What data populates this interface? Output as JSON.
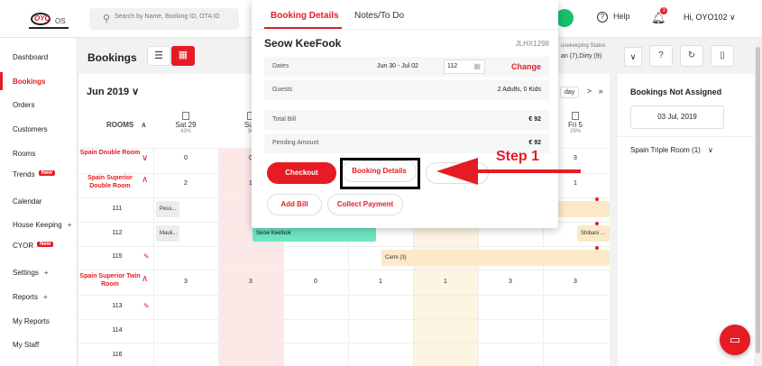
{
  "header": {
    "logo_text": "OYO",
    "logo_suffix": "OS",
    "search_placeholder": "Search by Name, Booking ID, OTA ID",
    "help_label": "Help",
    "notification_count": "3",
    "user_label": "Hi, OYO102 ∨"
  },
  "sidebar": {
    "items": [
      {
        "label": "Dashboard"
      },
      {
        "label": "Bookings"
      },
      {
        "label": "Orders"
      },
      {
        "label": "Customers"
      },
      {
        "label": "Rooms"
      },
      {
        "label": "Trends"
      },
      {
        "label": "Calendar"
      },
      {
        "label": "House Keeping"
      },
      {
        "label": "CYOR"
      },
      {
        "label": "Settings"
      },
      {
        "label": "Reports"
      },
      {
        "label": "My Reports"
      },
      {
        "label": "My Staff"
      }
    ],
    "new_badge": "New",
    "plus": "+"
  },
  "main": {
    "title": "Bookings",
    "month": "Jun 2019",
    "rooms_header": "ROOMS",
    "housekeeping_label": "usekeeping Status",
    "housekeeping_value": "an (7),Dirty (9)",
    "nav_day": "day",
    "nav_next": ">",
    "nav_last": "»"
  },
  "grid": {
    "columns": [
      {
        "day": "Sat 29",
        "pct": "43%"
      },
      {
        "day": "Sun",
        "pct": "36"
      },
      {
        "day": "",
        "pct": ""
      },
      {
        "day": "",
        "pct": ""
      },
      {
        "day": "",
        "pct": ""
      },
      {
        "day": "Fri 5",
        "pct": "29%"
      }
    ],
    "rows": {
      "spain_double": "Spain Double Room",
      "spain_superior_double": "Spain Superior Double Room",
      "r111": "111",
      "r112": "112",
      "r115": "115",
      "spain_superior_twin": "Spain Superior Twin Room",
      "r113": "113",
      "r114": "114",
      "r116": "116"
    },
    "counts": {
      "double": [
        "0",
        "0",
        "3"
      ],
      "superior_double": [
        "2",
        "1",
        "1"
      ],
      "twin": [
        "3",
        "3",
        "0",
        "1",
        "1",
        "3",
        "3"
      ]
    },
    "bookings": {
      "pess": "Pess...",
      "mauli": "Mauli...",
      "seow": "Seow Keefook",
      "carm": "Carm (3)",
      "shibani": "Shibani ..."
    }
  },
  "right_panel": {
    "title": "Bookings Not Assigned",
    "date": "03 Jul, 2019",
    "room": "Spain Triple Room (1)"
  },
  "popup": {
    "tab_active": "Booking Details",
    "tab_other": "Notes/To Do",
    "guest_name": "Seow KeeFook",
    "booking_id": "JLHX1298",
    "dates_label": "Dates",
    "dates_value": "Jun 30 - Jul 02",
    "room_no": "112",
    "change_link": "Change",
    "guests_label": "Guests",
    "guests_value": "2 Adults, 0 Kids",
    "total_label": "Total Bill",
    "total_value": "€ 92",
    "pending_label": "Pending Amount",
    "pending_value": "€ 92",
    "checkout_btn": "Checkout",
    "booking_details_btn": "Booking Details",
    "add_bill_btn": "Add Bill",
    "collect_payment_btn": "Collect Payment"
  },
  "annotation": {
    "step_label": "Step 1"
  },
  "colors": {
    "brand": "#e51c23",
    "booking_green": "#6ee6c2"
  }
}
